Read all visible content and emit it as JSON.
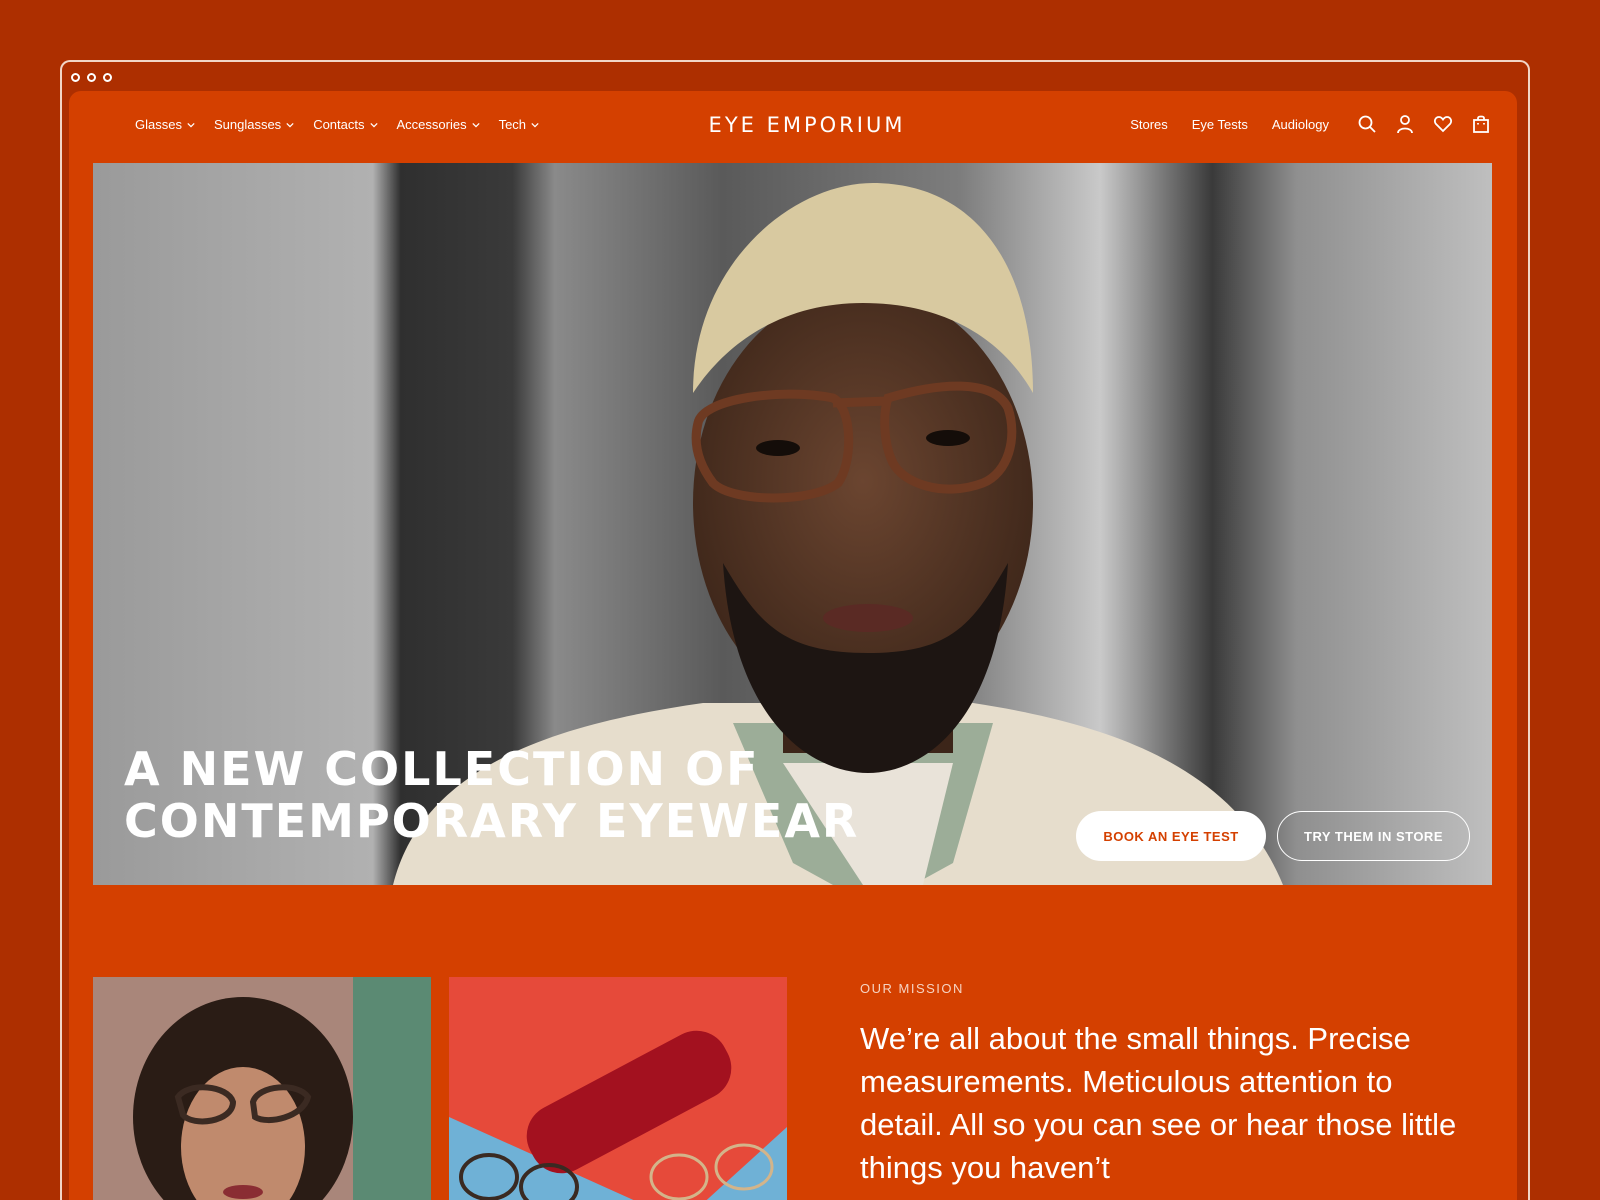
{
  "brand": {
    "logo": "EYE EMPORIUM"
  },
  "nav": {
    "left": [
      {
        "label": "Glasses"
      },
      {
        "label": "Sunglasses"
      },
      {
        "label": "Contacts"
      },
      {
        "label": "Accessories"
      },
      {
        "label": "Tech"
      }
    ],
    "right": [
      {
        "label": "Stores"
      },
      {
        "label": "Eye Tests"
      },
      {
        "label": "Audiology"
      }
    ],
    "icons": [
      "search-icon",
      "account-icon",
      "wishlist-heart-icon",
      "shopping-bag-icon"
    ]
  },
  "hero": {
    "headline_line1": "A NEW COLLECTION OF",
    "headline_line2": "CONTEMPORARY EYEWEAR",
    "primary_button": "BOOK AN EYE TEST",
    "secondary_button": "TRY THEM IN STORE"
  },
  "mission": {
    "label": "OUR MISSION",
    "text": "We’re all about the small things. Precise measurements. Meticulous attention to detail. All so you can see or hear those little things you haven’t"
  },
  "colors": {
    "background": "#ad2f00",
    "page": "#d44000",
    "accent": "#d44000",
    "text": "#ffffff"
  }
}
